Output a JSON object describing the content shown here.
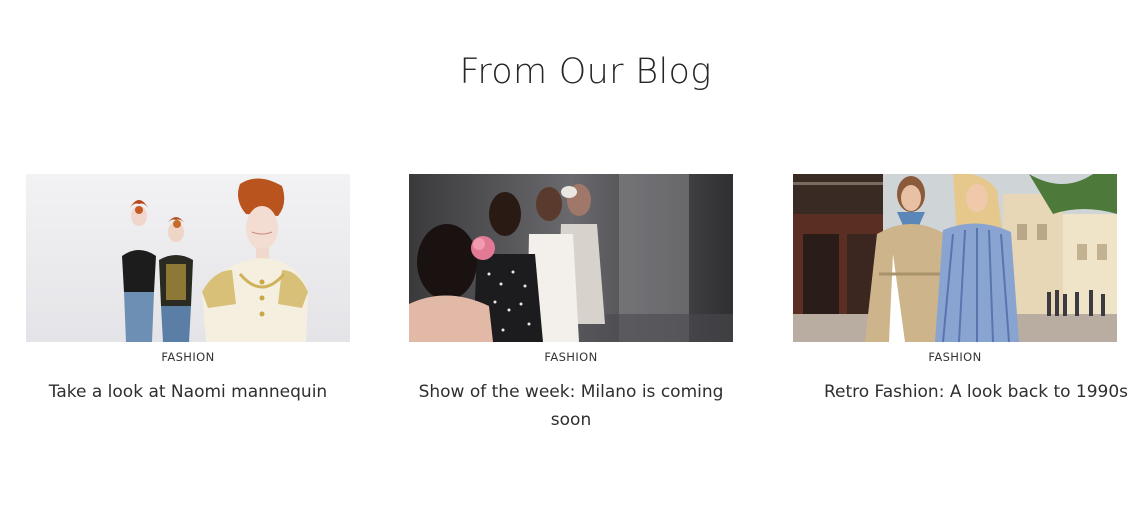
{
  "section": {
    "title": "From Our Blog"
  },
  "posts": [
    {
      "category": "FASHION",
      "title": "Take a look at Naomi mannequin",
      "image": "mannequins-photo"
    },
    {
      "category": "FASHION",
      "title": "Show of the week: Milano is coming soon",
      "image": "runway-show-photo"
    },
    {
      "category": "FASHION",
      "title": "Retro Fashion: A look back to 1990s",
      "image": "street-style-women-photo"
    }
  ]
}
